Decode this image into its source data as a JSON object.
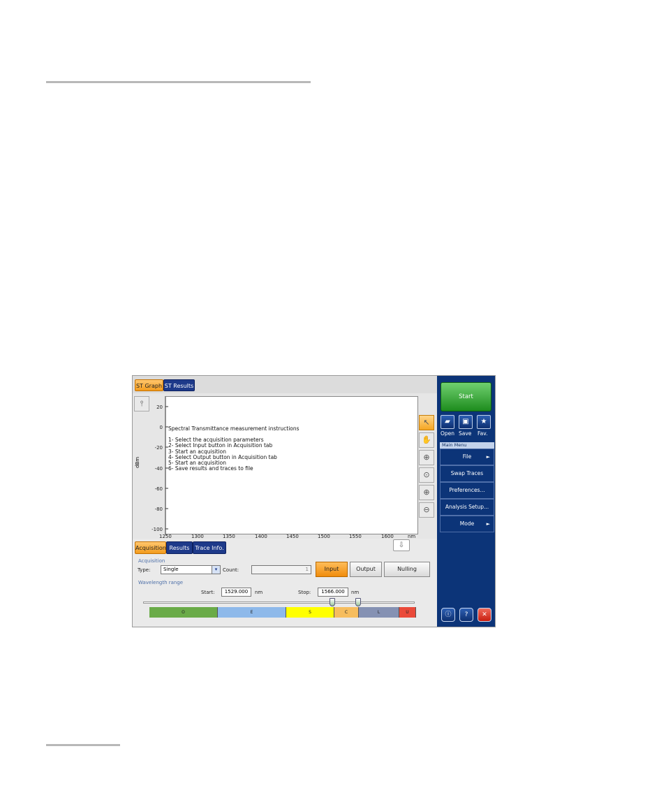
{
  "tabs_top": [
    {
      "label": "ST Graph"
    },
    {
      "label": "ST Results"
    }
  ],
  "graph": {
    "instructions_title": "Spectral Transmittance measurement instructions",
    "instructions": [
      "1- Select the acquisition parameters",
      "2- Select Input button in Acquisition tab",
      "3- Start an acquisition",
      "4- Select Output button in Acquisition tab",
      "5- Start an acquisition",
      "6- Save results and traces to file"
    ],
    "ylabel": "dBm",
    "yticks": [
      "20",
      "0",
      "-20",
      "-40",
      "-60",
      "-80",
      "-100"
    ],
    "xticks": [
      "1250",
      "1300",
      "1350",
      "1400",
      "1450",
      "1500",
      "1550",
      "1600"
    ],
    "xunit": "nm"
  },
  "tabs_bottom": [
    {
      "label": "Acquisition"
    },
    {
      "label": "Results"
    },
    {
      "label": "Trace Info."
    }
  ],
  "acquisition": {
    "group_label": "Acquisition",
    "type_label": "Type:",
    "type_value": "Single",
    "count_label": "Count:",
    "count_value": "1",
    "input_label": "Input",
    "output_label": "Output",
    "nulling_label": "Nulling"
  },
  "wavelength": {
    "group_label": "Wavelength range",
    "start_label": "Start:",
    "start_value": "1529.000",
    "stop_label": "Stop:",
    "stop_value": "1566.000",
    "unit": "nm",
    "bands": [
      "O",
      "E",
      "S",
      "C",
      "L",
      "U"
    ]
  },
  "sidebar": {
    "start_label": "Start",
    "open_label": "Open",
    "save_label": "Save",
    "fav_label": "Fav.",
    "menu_header": "Main Menu",
    "menu_items": [
      {
        "label": "File",
        "has_arrow": true
      },
      {
        "label": "Swap Traces",
        "has_arrow": false
      },
      {
        "label": "Preferences...",
        "has_arrow": false
      },
      {
        "label": "Analysis Setup...",
        "has_arrow": false
      },
      {
        "label": "Mode",
        "has_arrow": true
      }
    ],
    "arrow": "►"
  },
  "colors": {
    "band_o": "#6aab48",
    "band_e": "#8eb9ea",
    "band_s": "#ffff00",
    "band_c": "#f6bd5e",
    "band_l": "#8591b3",
    "band_u": "#ea4a3a",
    "sidebar": "#0c3478",
    "accent_orange": "#f39c1e"
  }
}
